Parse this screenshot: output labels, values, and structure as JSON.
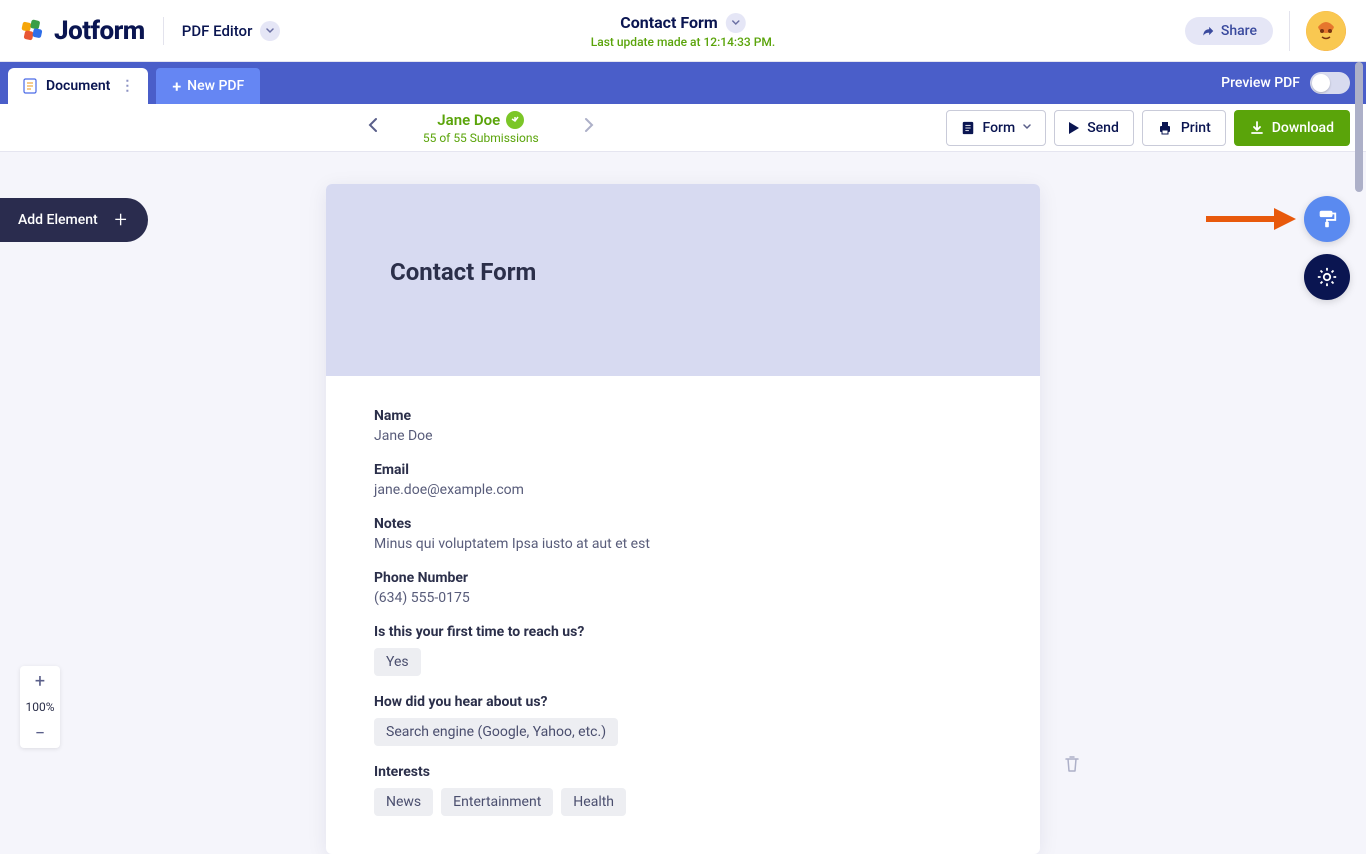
{
  "header": {
    "brand": "Jotform",
    "pdf_editor_label": "PDF Editor",
    "title": "Contact Form",
    "last_update_prefix": "Last update made at ",
    "last_update_time": "12:14:33 PM",
    "share_label": "Share"
  },
  "bluebar": {
    "document_tab": "Document",
    "new_pdf": "New PDF",
    "preview_label": "Preview PDF"
  },
  "submission_bar": {
    "name": "Jane Doe",
    "count_text": "55 of 55 Submissions",
    "form_btn": "Form",
    "send_btn": "Send",
    "print_btn": "Print",
    "download_btn": "Download"
  },
  "add_element_label": "Add Element",
  "zoom": {
    "level": "100%"
  },
  "form": {
    "title": "Contact Form",
    "fields": [
      {
        "label": "Name",
        "value": "Jane Doe",
        "type": "text"
      },
      {
        "label": "Email",
        "value": "jane.doe@example.com",
        "type": "text"
      },
      {
        "label": "Notes",
        "value": "Minus qui voluptatem Ipsa iusto at aut et est",
        "type": "text"
      },
      {
        "label": "Phone Number",
        "value": "(634) 555-0175",
        "type": "text"
      },
      {
        "label": "Is this your first time to reach us?",
        "chips": [
          "Yes"
        ],
        "type": "chips"
      },
      {
        "label": "How did you hear about us?",
        "chips": [
          "Search engine (Google, Yahoo, etc.)"
        ],
        "type": "chips"
      },
      {
        "label": "Interests",
        "chips": [
          "News",
          "Entertainment",
          "Health"
        ],
        "type": "chips"
      }
    ]
  }
}
